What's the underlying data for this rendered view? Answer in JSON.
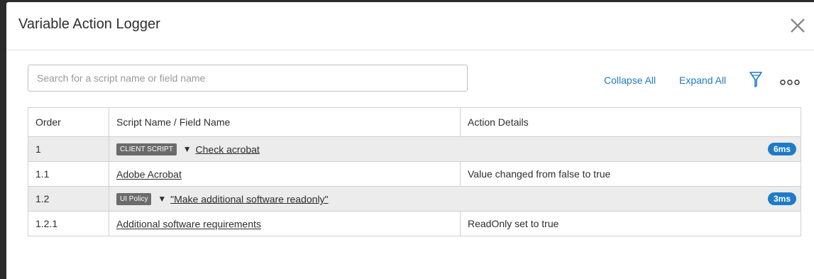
{
  "dialog": {
    "title": "Variable Action Logger"
  },
  "search": {
    "placeholder": "Search for a script name or field name",
    "value": ""
  },
  "toolbar": {
    "collapse_all": "Collapse All",
    "expand_all": "Expand All",
    "filter_icon": "filter-icon",
    "more_icon": "more-icon"
  },
  "table": {
    "headers": {
      "order": "Order",
      "script_field": "Script Name / Field Name",
      "action_details": "Action Details"
    },
    "rows": [
      {
        "order": "1",
        "tag": "CLIENT SCRIPT",
        "name": "Check acrobat",
        "time": "6ms",
        "group": true
      },
      {
        "order": "1.1",
        "name": "Adobe Acrobat",
        "details": "Value changed from false to true"
      },
      {
        "order": "1.2",
        "tag": "UI Policy",
        "name": "\"Make additional software readonly\"",
        "time": "3ms",
        "group": true
      },
      {
        "order": "1.2.1",
        "name": "Additional software requirements",
        "details": "ReadOnly set to true"
      }
    ]
  },
  "colors": {
    "accent": "#1f7bc7",
    "tag_bg": "#6b6b6b",
    "group_row_bg": "#ececec"
  }
}
